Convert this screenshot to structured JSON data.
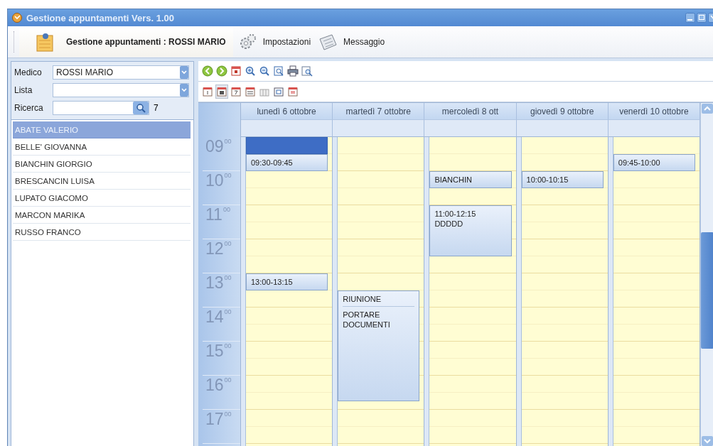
{
  "window": {
    "title": "Gestione appuntamenti Vers. 1.00"
  },
  "toolbar": [
    {
      "kind": "doctor",
      "label": "Gestione appuntamenti : ROSSI MARIO",
      "selected": true
    },
    {
      "kind": "settings",
      "label": "Impostazioni",
      "selected": false
    },
    {
      "kind": "message",
      "label": "Messaggio",
      "selected": false
    }
  ],
  "filters": [
    {
      "kind": "select",
      "label": "Medico",
      "value": "ROSSI MARIO"
    },
    {
      "kind": "select",
      "label": "Lista"
    },
    {
      "kind": "search",
      "label": "Ricerca",
      "count": "7"
    }
  ],
  "patients": [
    {
      "name": "ABATE VALERIO",
      "selected": true
    },
    {
      "name": "BELLE' GIOVANNA",
      "selected": false
    },
    {
      "name": "BIANCHIN GIORGIO",
      "selected": false
    },
    {
      "name": "BRESCANCIN LUISA",
      "selected": false
    },
    {
      "name": "LUPATO GIACOMO",
      "selected": false
    },
    {
      "name": "MARCON MARIKA",
      "selected": false
    },
    {
      "name": "RUSSO FRANCO",
      "selected": false
    }
  ],
  "nav_tools": [
    {
      "kind": "back"
    },
    {
      "kind": "forward"
    },
    {
      "kind": "today"
    },
    {
      "kind": "zoom-in"
    },
    {
      "kind": "zoom-out"
    },
    {
      "kind": "zoom-fit"
    },
    {
      "kind": "print"
    },
    {
      "kind": "preview"
    }
  ],
  "view_buttons": [
    {
      "kind": "day",
      "selected": false
    },
    {
      "kind": "workweek",
      "selected": true
    },
    {
      "kind": "week",
      "selected": false
    },
    {
      "kind": "month",
      "selected": false
    },
    {
      "kind": "timeline",
      "selected": false
    },
    {
      "kind": "grid",
      "selected": false
    },
    {
      "kind": "year",
      "selected": false
    }
  ],
  "calendar": {
    "hours": [
      "09$^{00}$",
      "10$^{00}$",
      "11$^{00}$",
      "12$^{00}$",
      "13$^{00}$",
      "14$^{00}$",
      "15$^{00}$",
      "16$^{00}$",
      "17$^{00}$"
    ],
    "days": [
      {
        "label": "lunedì 6 ottobre",
        "events": [
          {
            "kind": "selection"
          },
          {
            "kind": "appointment",
            "lines": [
              "09:30-09:45"
            ]
          },
          {
            "kind": "appointment",
            "lines": [
              "13:00-13:15"
            ]
          }
        ]
      },
      {
        "label": "martedì 7 ottobre",
        "events": [
          {
            "kind": "meeting",
            "lines": [
              "RIUNIONE",
              "PORTARE DOCUMENTI"
            ]
          }
        ]
      },
      {
        "label": "mercoledì 8 ott",
        "events": [
          {
            "kind": "appointment",
            "lines": [
              "BIANCHIN"
            ]
          },
          {
            "kind": "appointment",
            "lines": [
              "11:00-12:15",
              "DDDDD"
            ]
          }
        ]
      },
      {
        "label": "giovedì 9 ottobre",
        "events": [
          {
            "kind": "appointment",
            "lines": [
              "10:00-10:15"
            ]
          }
        ]
      },
      {
        "label": "venerdì 10 ottobre",
        "events": [
          {
            "kind": "appointment",
            "lines": [
              "09:45-10:00"
            ]
          }
        ]
      }
    ]
  }
}
